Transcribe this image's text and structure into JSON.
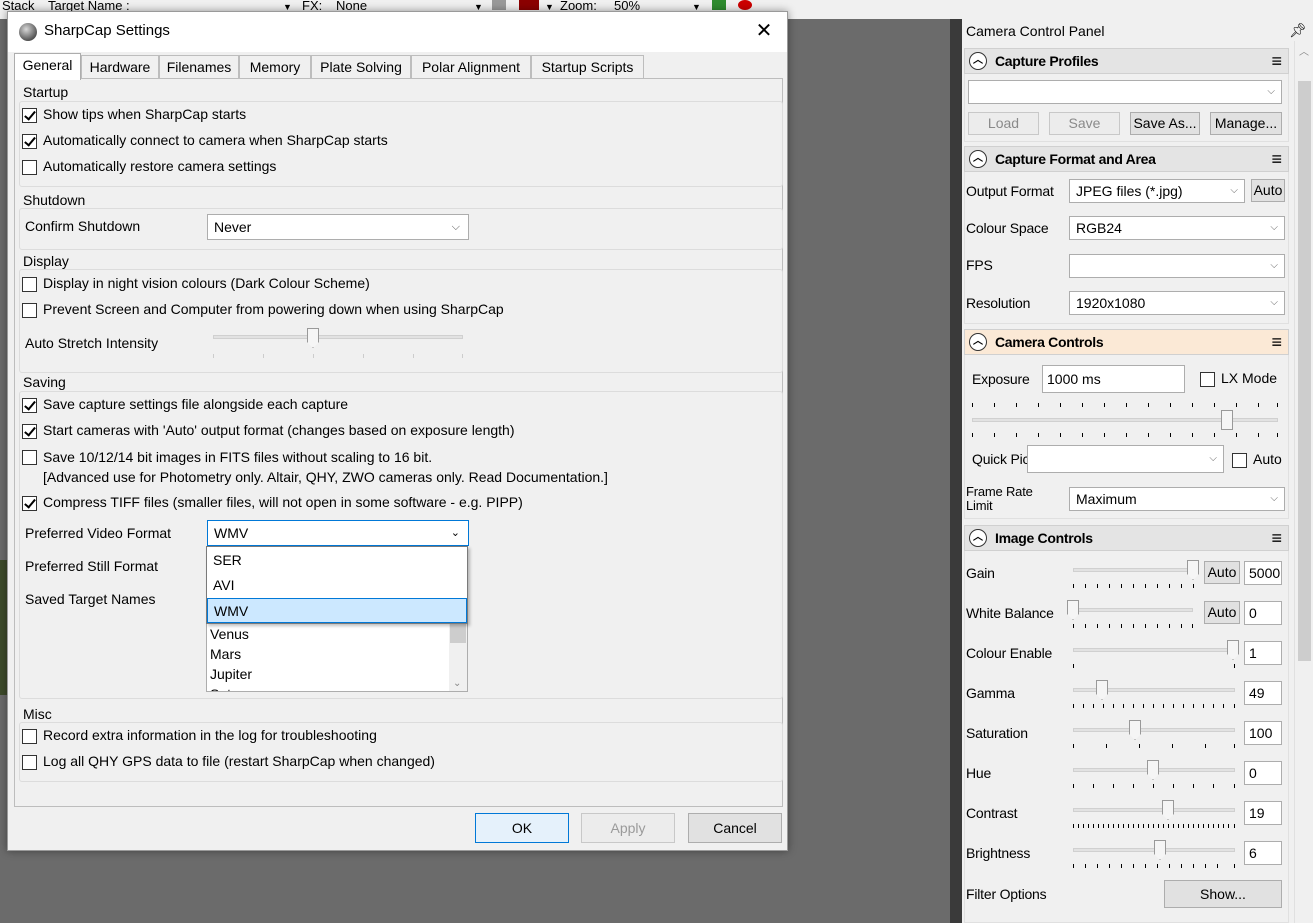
{
  "topbar": {
    "stack": "Stack",
    "target_name_label": "Target Name :",
    "fx_label": "FX:",
    "fx_value": "None",
    "zoom_label": "Zoom:",
    "zoom_value": "50%"
  },
  "dialog": {
    "title": "SharpCap Settings",
    "close": "✕",
    "tabs": [
      "General",
      "Hardware",
      "Filenames",
      "Memory",
      "Plate Solving",
      "Polar Alignment",
      "Startup Scripts"
    ],
    "active_tab": "General",
    "startup": {
      "label": "Startup",
      "show_tips": "Show tips when SharpCap starts",
      "auto_connect": "Automatically connect to camera when SharpCap starts",
      "auto_restore": "Automatically restore camera settings"
    },
    "shutdown": {
      "label": "Shutdown",
      "confirm_label": "Confirm Shutdown",
      "confirm_value": "Never"
    },
    "display": {
      "label": "Display",
      "night_vision": "Display in night vision colours (Dark Colour Scheme)",
      "prevent_sleep": "Prevent Screen and Computer from powering down when using SharpCap",
      "auto_stretch_label": "Auto Stretch Intensity"
    },
    "saving": {
      "label": "Saving",
      "save_settings_file": "Save capture settings file alongside each capture",
      "auto_output_format": "Start cameras with 'Auto' output format (changes based on exposure length)",
      "save_fits_line1": "Save 10/12/14 bit images in FITS files without scaling to 16 bit.",
      "save_fits_line2": "[Advanced use for Photometry only. Altair, QHY, ZWO cameras only. Read Documentation.]",
      "compress_tiff": "Compress TIFF files (smaller files, will not open in some software - e.g. PIPP)",
      "video_format_label": "Preferred Video Format",
      "video_format_value": "WMV",
      "video_format_options": [
        "SER",
        "AVI",
        "WMV"
      ],
      "still_format_label": "Preferred Still Format",
      "target_names_label": "Saved Target Names",
      "target_names": [
        "Venus",
        "Mars",
        "Jupiter",
        "Saturn"
      ]
    },
    "misc": {
      "label": "Misc",
      "extra_log": "Record extra information in the log for troubleshooting",
      "qhy_gps": "Log all QHY GPS data to file (restart SharpCap when changed)"
    },
    "buttons": {
      "ok": "OK",
      "apply": "Apply",
      "cancel": "Cancel"
    }
  },
  "camera_panel": {
    "title": "Camera Control Panel",
    "capture_profiles": {
      "title": "Capture Profiles",
      "load": "Load",
      "save": "Save",
      "save_as": "Save As...",
      "manage": "Manage..."
    },
    "capture_format": {
      "title": "Capture Format and Area",
      "output_format_label": "Output Format",
      "output_format_value": "JPEG files (*.jpg)",
      "auto": "Auto",
      "colour_space_label": "Colour Space",
      "colour_space_value": "RGB24",
      "fps_label": "FPS",
      "resolution_label": "Resolution",
      "resolution_value": "1920x1080"
    },
    "camera_controls": {
      "title": "Camera Controls",
      "exposure_label": "Exposure",
      "exposure_value": "1000 ms",
      "lx_mode": "LX Mode",
      "quick_picks_label": "Quick Picks",
      "auto": "Auto",
      "frame_rate_label_1": "Frame Rate",
      "frame_rate_label_2": "Limit",
      "frame_rate_value": "Maximum"
    },
    "image_controls": {
      "title": "Image Controls",
      "auto": "Auto",
      "gain_label": "Gain",
      "gain_value": "5000",
      "wb_label": "White Balance",
      "wb_value": "0",
      "colour_enable_label": "Colour Enable",
      "colour_enable_value": "1",
      "gamma_label": "Gamma",
      "gamma_value": "49",
      "saturation_label": "Saturation",
      "saturation_value": "100",
      "hue_label": "Hue",
      "hue_value": "0",
      "contrast_label": "Contrast",
      "contrast_value": "19",
      "brightness_label": "Brightness",
      "brightness_value": "6",
      "filter_options_label": "Filter Options",
      "show_button": "Show..."
    }
  },
  "colors": {
    "accent": "#0078d7",
    "selection": "#cce8ff",
    "highlight_header": "#fbe9d6"
  }
}
